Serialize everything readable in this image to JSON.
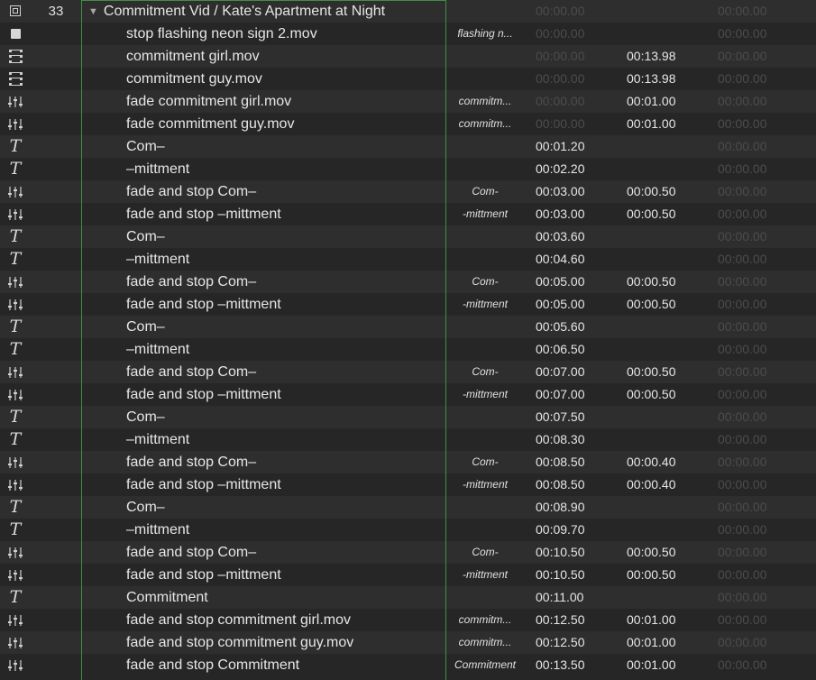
{
  "group": {
    "number": "33",
    "name": "Commitment Vid / Kate's Apartment at Night",
    "icon": "group-icon",
    "t1": "00:00.00",
    "t3": "00:00.00"
  },
  "placeholder_time": "00:00.00",
  "cues": [
    {
      "icon": "stop-icon",
      "name": "stop flashing neon sign 2.mov",
      "target": "flashing n...",
      "t1": "00:00.00",
      "t1_dim": true,
      "t2": "",
      "t3": "00:00.00"
    },
    {
      "icon": "film-icon",
      "name": "commitment girl.mov",
      "target": "",
      "t1": "00:00.00",
      "t1_dim": true,
      "t2": "00:13.98",
      "t3": "00:00.00"
    },
    {
      "icon": "film-icon",
      "name": "commitment guy.mov",
      "target": "",
      "t1": "00:00.00",
      "t1_dim": true,
      "t2": "00:13.98",
      "t3": "00:00.00"
    },
    {
      "icon": "fade-icon",
      "name": "fade commitment girl.mov",
      "target": "commitm...",
      "t1": "00:00.00",
      "t1_dim": true,
      "t2": "00:01.00",
      "t3": "00:00.00"
    },
    {
      "icon": "fade-icon",
      "name": "fade commitment guy.mov",
      "target": "commitm...",
      "t1": "00:00.00",
      "t1_dim": true,
      "t2": "00:01.00",
      "t3": "00:00.00"
    },
    {
      "icon": "text-icon",
      "name": "Com–",
      "target": "",
      "t1": "00:01.20",
      "t1_dim": false,
      "t2": "",
      "t3": "00:00.00"
    },
    {
      "icon": "text-icon",
      "name": "–mittment",
      "target": "",
      "t1": "00:02.20",
      "t1_dim": false,
      "t2": "",
      "t3": "00:00.00"
    },
    {
      "icon": "fade-icon",
      "name": "fade and stop Com–",
      "target": "Com-",
      "t1": "00:03.00",
      "t1_dim": false,
      "t2": "00:00.50",
      "t3": "00:00.00"
    },
    {
      "icon": "fade-icon",
      "name": "fade and stop –mittment",
      "target": "-mittment",
      "t1": "00:03.00",
      "t1_dim": false,
      "t2": "00:00.50",
      "t3": "00:00.00"
    },
    {
      "icon": "text-icon",
      "name": "Com–",
      "target": "",
      "t1": "00:03.60",
      "t1_dim": false,
      "t2": "",
      "t3": "00:00.00"
    },
    {
      "icon": "text-icon",
      "name": "–mittment",
      "target": "",
      "t1": "00:04.60",
      "t1_dim": false,
      "t2": "",
      "t3": "00:00.00"
    },
    {
      "icon": "fade-icon",
      "name": "fade and stop Com–",
      "target": "Com-",
      "t1": "00:05.00",
      "t1_dim": false,
      "t2": "00:00.50",
      "t3": "00:00.00"
    },
    {
      "icon": "fade-icon",
      "name": "fade and stop –mittment",
      "target": "-mittment",
      "t1": "00:05.00",
      "t1_dim": false,
      "t2": "00:00.50",
      "t3": "00:00.00"
    },
    {
      "icon": "text-icon",
      "name": "Com–",
      "target": "",
      "t1": "00:05.60",
      "t1_dim": false,
      "t2": "",
      "t3": "00:00.00"
    },
    {
      "icon": "text-icon",
      "name": "–mittment",
      "target": "",
      "t1": "00:06.50",
      "t1_dim": false,
      "t2": "",
      "t3": "00:00.00"
    },
    {
      "icon": "fade-icon",
      "name": "fade and stop Com–",
      "target": "Com-",
      "t1": "00:07.00",
      "t1_dim": false,
      "t2": "00:00.50",
      "t3": "00:00.00"
    },
    {
      "icon": "fade-icon",
      "name": "fade and stop –mittment",
      "target": "-mittment",
      "t1": "00:07.00",
      "t1_dim": false,
      "t2": "00:00.50",
      "t3": "00:00.00"
    },
    {
      "icon": "text-icon",
      "name": "Com–",
      "target": "",
      "t1": "00:07.50",
      "t1_dim": false,
      "t2": "",
      "t3": "00:00.00"
    },
    {
      "icon": "text-icon",
      "name": "–mittment",
      "target": "",
      "t1": "00:08.30",
      "t1_dim": false,
      "t2": "",
      "t3": "00:00.00"
    },
    {
      "icon": "fade-icon",
      "name": "fade and stop Com–",
      "target": "Com-",
      "t1": "00:08.50",
      "t1_dim": false,
      "t2": "00:00.40",
      "t3": "00:00.00"
    },
    {
      "icon": "fade-icon",
      "name": "fade and stop –mittment",
      "target": "-mittment",
      "t1": "00:08.50",
      "t1_dim": false,
      "t2": "00:00.40",
      "t3": "00:00.00"
    },
    {
      "icon": "text-icon",
      "name": "Com–",
      "target": "",
      "t1": "00:08.90",
      "t1_dim": false,
      "t2": "",
      "t3": "00:00.00"
    },
    {
      "icon": "text-icon",
      "name": "–mittment",
      "target": "",
      "t1": "00:09.70",
      "t1_dim": false,
      "t2": "",
      "t3": "00:00.00"
    },
    {
      "icon": "fade-icon",
      "name": "fade and stop Com–",
      "target": "Com-",
      "t1": "00:10.50",
      "t1_dim": false,
      "t2": "00:00.50",
      "t3": "00:00.00"
    },
    {
      "icon": "fade-icon",
      "name": "fade and stop –mittment",
      "target": "-mittment",
      "t1": "00:10.50",
      "t1_dim": false,
      "t2": "00:00.50",
      "t3": "00:00.00"
    },
    {
      "icon": "text-icon",
      "name": "Commitment",
      "target": "",
      "t1": "00:11.00",
      "t1_dim": false,
      "t2": "",
      "t3": "00:00.00"
    },
    {
      "icon": "fade-icon",
      "name": "fade and stop commitment girl.mov",
      "target": "commitm...",
      "t1": "00:12.50",
      "t1_dim": false,
      "t2": "00:01.00",
      "t3": "00:00.00"
    },
    {
      "icon": "fade-icon",
      "name": "fade and stop commitment guy.mov",
      "target": "commitm...",
      "t1": "00:12.50",
      "t1_dim": false,
      "t2": "00:01.00",
      "t3": "00:00.00"
    },
    {
      "icon": "fade-icon",
      "name": "fade and stop Commitment",
      "target": "Commitment",
      "t1": "00:13.50",
      "t1_dim": false,
      "t2": "00:01.00",
      "t3": "00:00.00"
    }
  ],
  "colors": {
    "background": "#262626",
    "row_alt": "#2e2e2e",
    "selection_outline": "#3f8f45",
    "dim_time": "#4c4c4c"
  }
}
